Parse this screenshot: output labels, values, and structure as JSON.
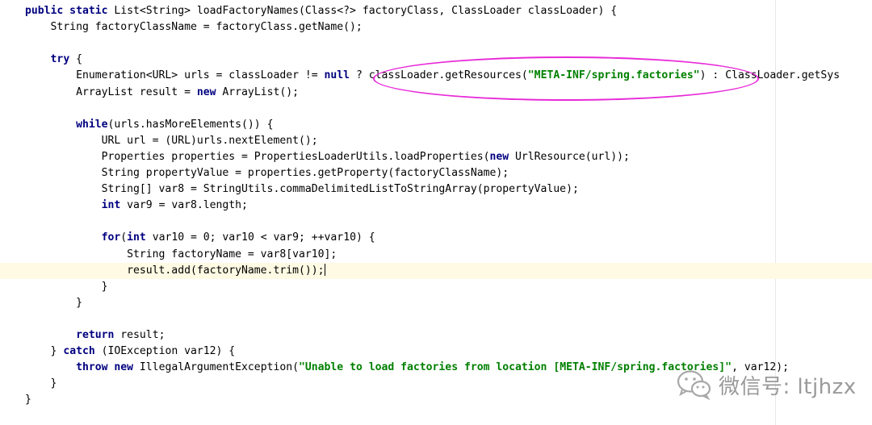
{
  "code_lines": [
    [
      {
        "t": "kw",
        "v": "public static "
      },
      {
        "t": "p",
        "v": "List<String> loadFactoryNames(Class<?> factoryClass, ClassLoader classLoader) {"
      }
    ],
    [
      {
        "t": "p",
        "v": "    String factoryClassName = factoryClass.getName();"
      }
    ],
    [],
    [
      {
        "t": "p",
        "v": "    "
      },
      {
        "t": "kw",
        "v": "try"
      },
      {
        "t": "p",
        "v": " {"
      }
    ],
    [
      {
        "t": "p",
        "v": "        Enumeration<URL> urls = classLoader != "
      },
      {
        "t": "kw",
        "v": "null"
      },
      {
        "t": "p",
        "v": " ? classLoader.getResources("
      },
      {
        "t": "str",
        "v": "\"META-INF/spring.factories\""
      },
      {
        "t": "p",
        "v": ") : ClassLoader.getSys"
      }
    ],
    [
      {
        "t": "p",
        "v": "        ArrayList result = "
      },
      {
        "t": "kw",
        "v": "new"
      },
      {
        "t": "p",
        "v": " ArrayList();"
      }
    ],
    [],
    [
      {
        "t": "p",
        "v": "        "
      },
      {
        "t": "kw",
        "v": "while"
      },
      {
        "t": "p",
        "v": "(urls.hasMoreElements()) {"
      }
    ],
    [
      {
        "t": "p",
        "v": "            URL url = (URL)urls.nextElement();"
      }
    ],
    [
      {
        "t": "p",
        "v": "            Properties properties = PropertiesLoaderUtils.loadProperties("
      },
      {
        "t": "kw",
        "v": "new"
      },
      {
        "t": "p",
        "v": " UrlResource(url));"
      }
    ],
    [
      {
        "t": "p",
        "v": "            String propertyValue = properties.getProperty(factoryClassName);"
      }
    ],
    [
      {
        "t": "p",
        "v": "            String[] var8 = StringUtils.commaDelimitedListToStringArray(propertyValue);"
      }
    ],
    [
      {
        "t": "p",
        "v": "            "
      },
      {
        "t": "kw",
        "v": "int"
      },
      {
        "t": "p",
        "v": " var9 = var8.length;"
      }
    ],
    [],
    [
      {
        "t": "p",
        "v": "            "
      },
      {
        "t": "kw",
        "v": "for"
      },
      {
        "t": "p",
        "v": "("
      },
      {
        "t": "kw",
        "v": "int"
      },
      {
        "t": "p",
        "v": " var10 = 0; var10 < var9; ++var10) {"
      }
    ],
    [
      {
        "t": "p",
        "v": "                String factoryName = var8[var10];"
      }
    ],
    [
      {
        "t": "p",
        "v": "                result.add(factoryName.trim());"
      },
      {
        "t": "caret",
        "v": ""
      }
    ],
    [
      {
        "t": "p",
        "v": "            }"
      }
    ],
    [
      {
        "t": "p",
        "v": "        }"
      }
    ],
    [],
    [
      {
        "t": "p",
        "v": "        "
      },
      {
        "t": "kw",
        "v": "return"
      },
      {
        "t": "p",
        "v": " result;"
      }
    ],
    [
      {
        "t": "p",
        "v": "    } "
      },
      {
        "t": "kw",
        "v": "catch"
      },
      {
        "t": "p",
        "v": " (IOException var12) {"
      }
    ],
    [
      {
        "t": "p",
        "v": "        "
      },
      {
        "t": "kw",
        "v": "throw new"
      },
      {
        "t": "p",
        "v": " IllegalArgumentException("
      },
      {
        "t": "str",
        "v": "\"Unable to load factories from location [META-INF/spring.factories]\""
      },
      {
        "t": "p",
        "v": ", var12);"
      }
    ],
    [
      {
        "t": "p",
        "v": "    }"
      }
    ],
    [
      {
        "t": "p",
        "v": "}"
      }
    ]
  ],
  "current_line": 16,
  "watermark": {
    "text": "微信号: ltjhzx",
    "icon": "wechat-icon"
  },
  "colors": {
    "keyword": "#000080",
    "string": "#008000",
    "highlight": "#fffae3",
    "annotation": "#e82ad8"
  }
}
